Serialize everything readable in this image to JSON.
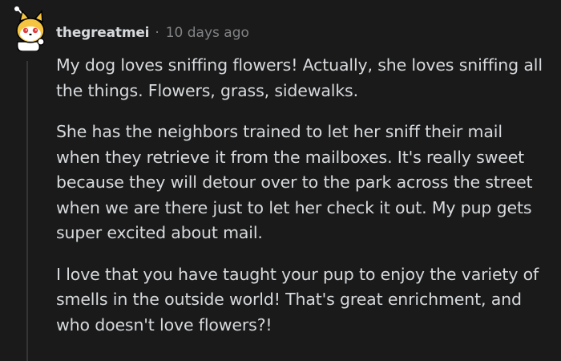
{
  "comment": {
    "author": "thegreatmei",
    "separator": "·",
    "timestamp": "10 days ago",
    "avatar_icon": "cat-avatar-icon",
    "paragraphs": [
      "My dog loves sniffing flowers! Actually, she loves sniffing all the things. Flowers, grass, sidewalks.",
      "She has the neighbors trained to let her sniff their mail when they retrieve it from the mailboxes. It's really sweet because they will detour over to the park across the street when we are there just to let her check it out. My pup gets super excited about mail.",
      "I love that you have taught your pup to enjoy the variety of smells in the outside world! That's great enrichment, and who doesn't love flowers?!"
    ]
  },
  "colors": {
    "background": "#1a1a1b",
    "text": "#d7dadc",
    "meta": "#818384",
    "thread_line": "#343536"
  }
}
